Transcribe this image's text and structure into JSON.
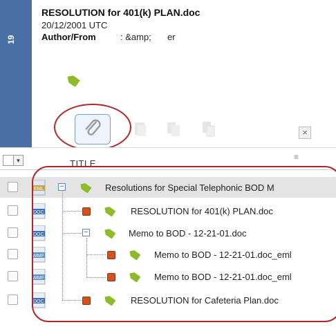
{
  "document": {
    "number": "19",
    "title": "RESOLUTION for 401(k) PLAN.doc",
    "date": "20/12/2001 UTC",
    "author_label": "Author/From",
    "author_value": ": &amp;",
    "author_tail": "er",
    "accent_color": "#4a6fa5"
  },
  "toolbar": {
    "attach_icon": "paperclip-icon",
    "close_label": "×"
  },
  "table": {
    "header_title": "TITLE",
    "header_menu": "≡",
    "header_drop": "▼"
  },
  "rows": [
    {
      "type": "EML",
      "label": "Resolutions for Special Telephonic BOD M",
      "expander": "−"
    },
    {
      "type": "DOC",
      "label": "RESOLUTION for 401(k) PLAN.doc"
    },
    {
      "type": "DOC",
      "label": "Memo to BOD - 12-21-01.doc",
      "expander": "−"
    },
    {
      "type": "WMF",
      "label": "Memo to BOD - 12-21-01.doc_eml"
    },
    {
      "type": "WMF",
      "label": "Memo to BOD - 12-21-01.doc_eml"
    },
    {
      "type": "DOC",
      "label": "RESOLUTION for Cafeteria Plan.doc"
    }
  ],
  "colors": {
    "highlight_circle": "#b0262a",
    "tag_green": "#8dbb2a",
    "flag_orange": "#d4521e"
  }
}
